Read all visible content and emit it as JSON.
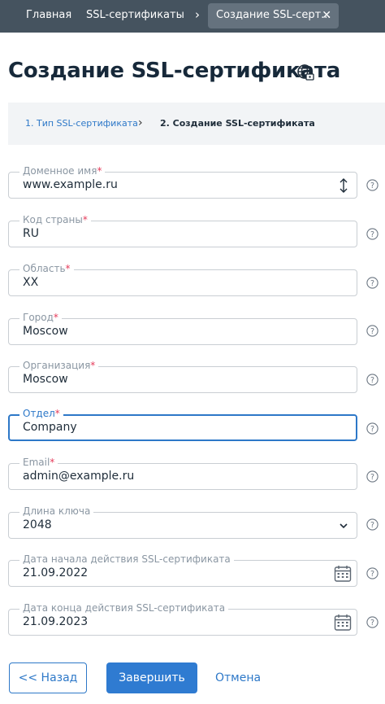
{
  "nav": {
    "home": "Главная",
    "ssl": "SSL-сертификаты",
    "active_tab": "Создание SSL-серт...",
    "separator": "›",
    "close": "✕"
  },
  "page": {
    "title": "Создание SSL-сертификата"
  },
  "stepper": {
    "step1": "1. Тип SSL-сертификата",
    "chevron": "›",
    "step2": "2. Создание SSL-сертификата"
  },
  "form": {
    "required_mark": "*",
    "fields": [
      {
        "label": "Доменное имя",
        "value": "www.example.ru",
        "required": true,
        "icon": "sort-arrows-icon"
      },
      {
        "label": "Код страны",
        "value": "RU",
        "required": true
      },
      {
        "label": "Область",
        "value": "XX",
        "required": true
      },
      {
        "label": "Город",
        "value": "Moscow",
        "required": true
      },
      {
        "label": "Организация",
        "value": "Moscow",
        "required": true
      },
      {
        "label": "Отдел",
        "value": "Company",
        "required": true,
        "focused": true
      },
      {
        "label": "Email",
        "value": "admin@example.ru",
        "required": true
      },
      {
        "label": "Длина ключа",
        "value": "2048",
        "required": false,
        "icon": "chevron-down-icon"
      },
      {
        "label": "Дата начала действия SSL-сертификата",
        "value": "21.09.2022",
        "required": false,
        "icon": "calendar-icon"
      },
      {
        "label": "Дата конца действия SSL-сертификата",
        "value": "21.09.2023",
        "required": false,
        "icon": "calendar-icon"
      }
    ]
  },
  "buttons": {
    "back": "<< Назад",
    "finish": "Завершить",
    "cancel": "Отмена"
  },
  "colors": {
    "nav_bg": "#45535f",
    "accent": "#2d78c8",
    "primary_button": "#2f7bd1",
    "required": "#e53b5a"
  }
}
